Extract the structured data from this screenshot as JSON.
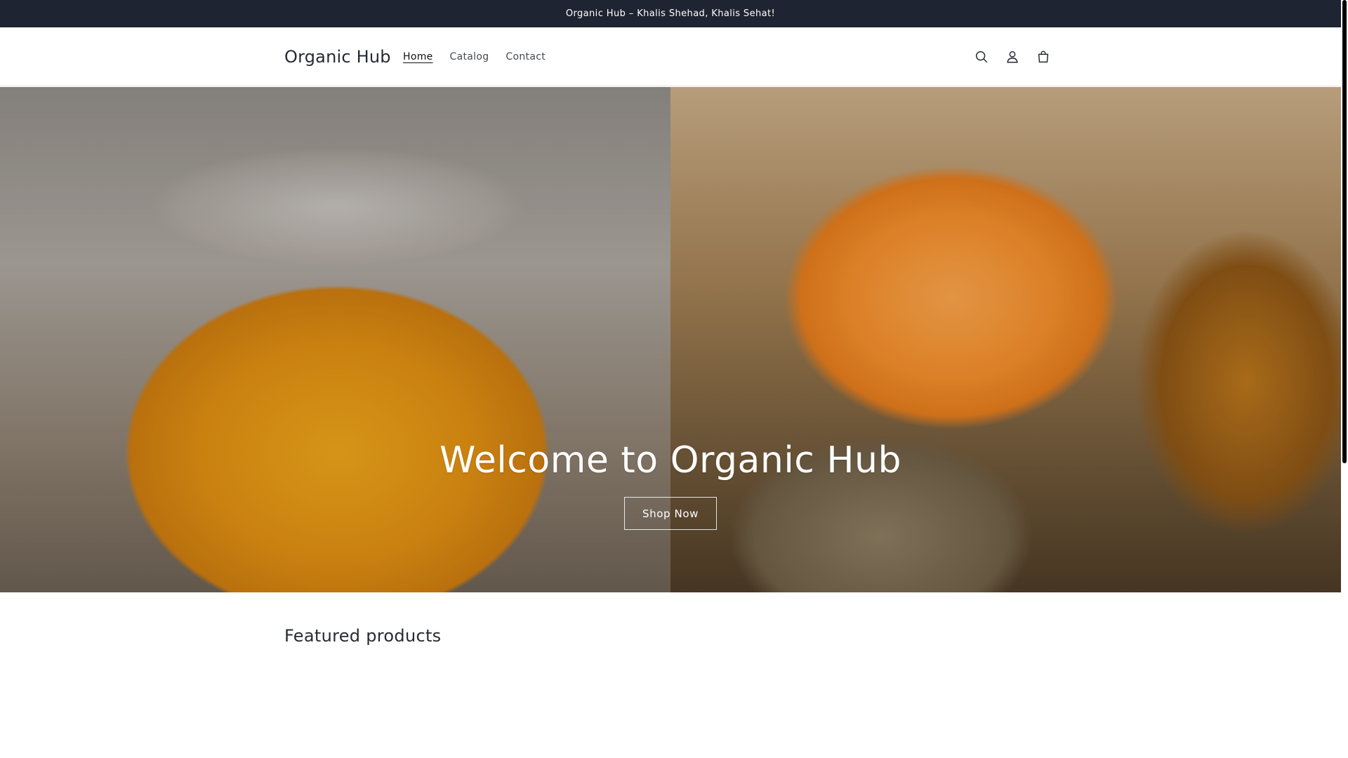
{
  "announcement": {
    "text": "Organic Hub – Khalis Shehad, Khalis Sehat!"
  },
  "header": {
    "logo": "Organic Hub",
    "nav": [
      {
        "label": "Home",
        "active": true
      },
      {
        "label": "Catalog",
        "active": false
      },
      {
        "label": "Contact",
        "active": false
      }
    ],
    "icons": [
      "search-icon",
      "account-icon",
      "cart-icon"
    ]
  },
  "hero": {
    "title": "Welcome to Organic Hub",
    "button_label": "Shop Now"
  },
  "featured": {
    "heading": "Featured products"
  },
  "colors": {
    "announcement_bg": "#1f2432",
    "text": "#262a33"
  }
}
